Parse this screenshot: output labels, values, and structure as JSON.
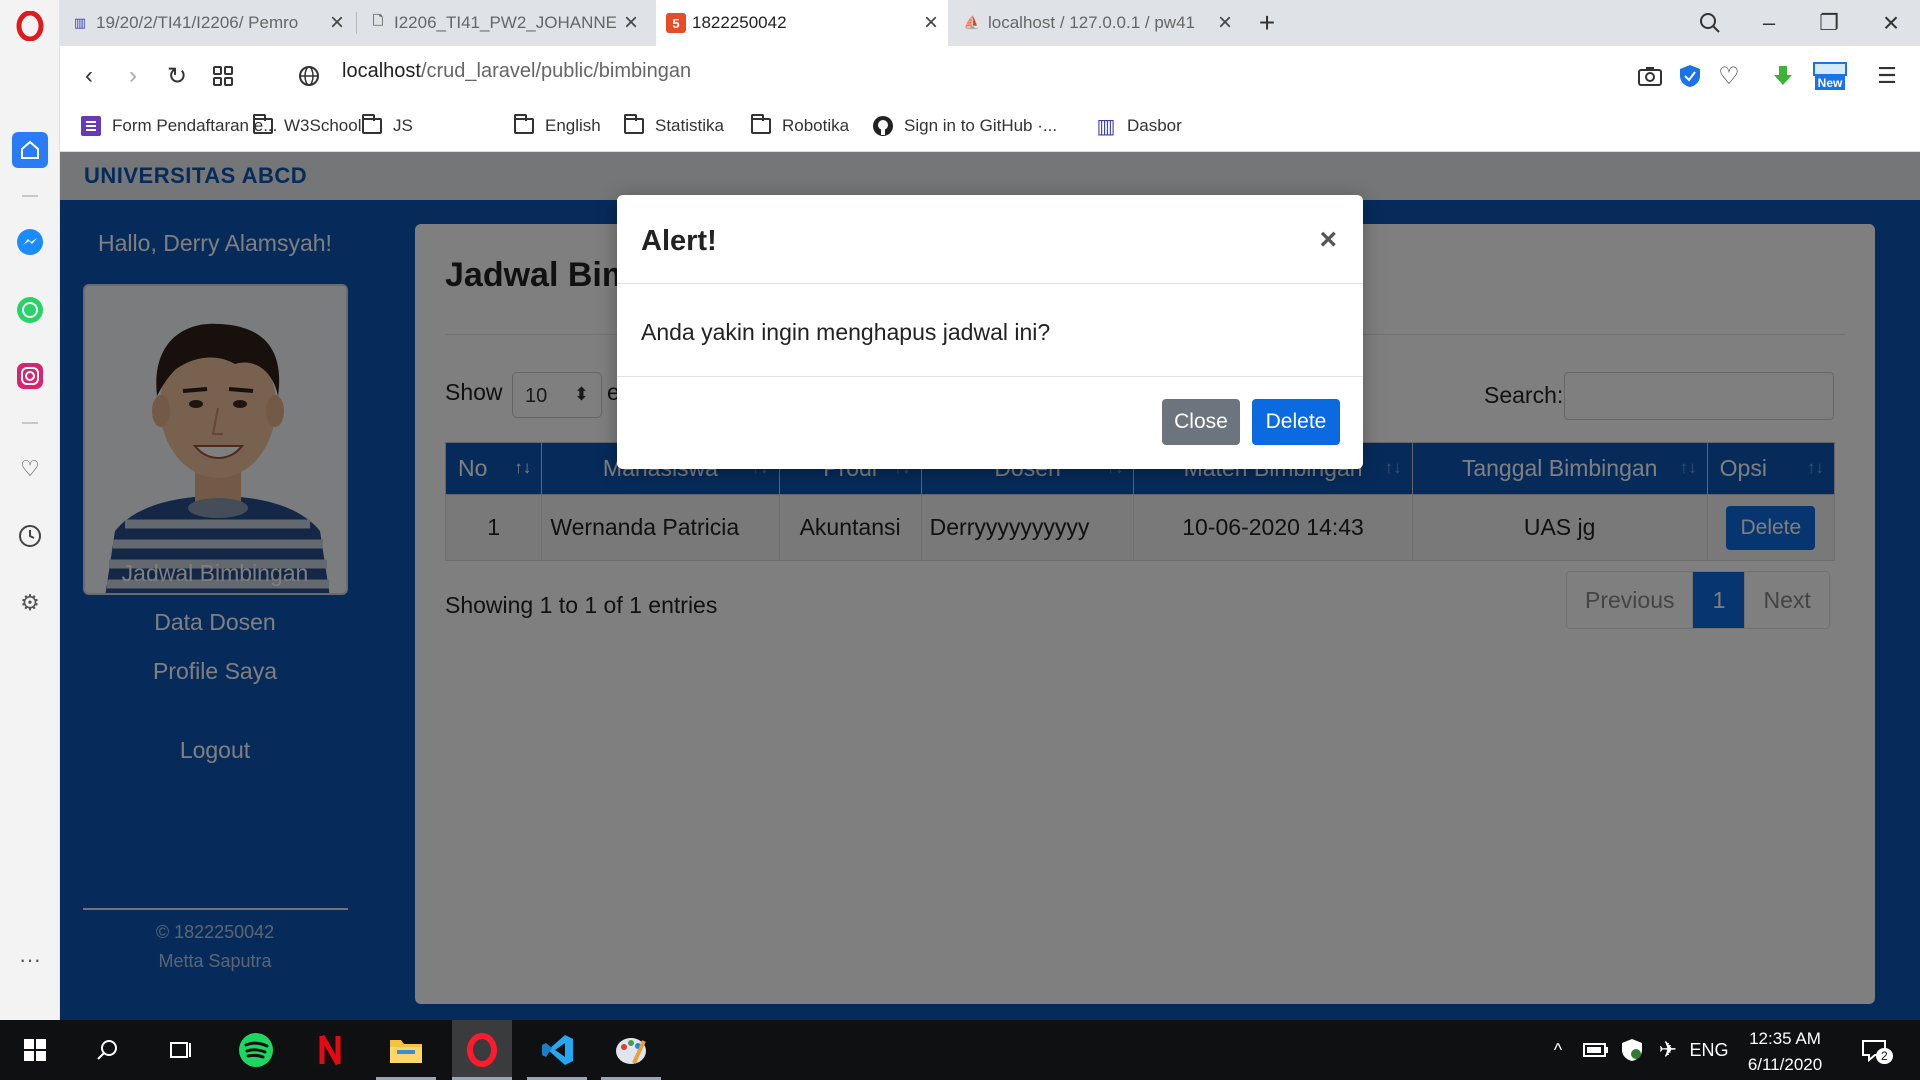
{
  "browser": {
    "tabs": [
      {
        "title": "19/20/2/TI41/I2206/ Pemro",
        "active": false
      },
      {
        "title": "I2206_TI41_PW2_JOHANNE",
        "active": false
      },
      {
        "title": "1822250042",
        "active": true
      },
      {
        "title": "localhost / 127.0.0.1 / pw41",
        "active": false
      }
    ],
    "url_host": "localhost",
    "url_path": "/crud_laravel/public/bimbingan",
    "bookmarks": [
      {
        "label": "Form Pendaftaran e...",
        "icon": "form-icon"
      },
      {
        "label": "W3School",
        "icon": "folder-icon"
      },
      {
        "label": "JS",
        "icon": "folder-icon"
      },
      {
        "label": "English",
        "icon": "folder-icon"
      },
      {
        "label": "Statistika",
        "icon": "folder-icon"
      },
      {
        "label": "Robotika",
        "icon": "folder-icon"
      },
      {
        "label": "Sign in to GitHub ·...",
        "icon": "github-icon"
      },
      {
        "label": "Dasbor",
        "icon": "library-icon"
      }
    ],
    "new_badge": "New"
  },
  "app": {
    "brand": "UNIVERSITAS ABCD",
    "greeting": "Hallo, Derry Alamsyah!",
    "nav": {
      "jadwal": "Jadwal Bimbingan",
      "dosen": "Data Dosen",
      "profile": "Profile Saya",
      "logout": "Logout"
    },
    "footer": {
      "copyright": "© 1822250042",
      "author": "Metta Saputra"
    }
  },
  "content": {
    "title": "Jadwal Bimbingan",
    "show_label": "Show",
    "page_length": "10",
    "entries_label": "entries",
    "search_label": "Search:",
    "columns": [
      "No",
      "Mahasiswa",
      "Prodi",
      "Dosen",
      "Materi Bimbingan",
      "Tanggal Bimbingan",
      "Opsi"
    ],
    "rows": [
      {
        "no": "1",
        "mahasiswa": "Wernanda Patricia",
        "prodi": "Akuntansi",
        "dosen": "Derryyyyyyyyyy",
        "materi": "10-06-2020 14:43",
        "tanggal": "UAS jg",
        "opsi": "Delete"
      }
    ],
    "info": "Showing 1 to 1 of 1 entries",
    "pagination": {
      "previous": "Previous",
      "current": "1",
      "next": "Next"
    }
  },
  "modal": {
    "title": "Alert!",
    "close_x": "×",
    "body": "Anda yakin ingin menghapus jadwal ini?",
    "close_button": "Close",
    "delete_button": "Delete"
  },
  "taskbar": {
    "language": "ENG",
    "time": "12:35 AM",
    "date": "6/11/2020",
    "notification_count": "2"
  },
  "colors": {
    "primary": "#0c57b7",
    "button_primary": "#0c6ae0",
    "button_secondary": "#6c757d",
    "opera_red": "#e0191d"
  }
}
